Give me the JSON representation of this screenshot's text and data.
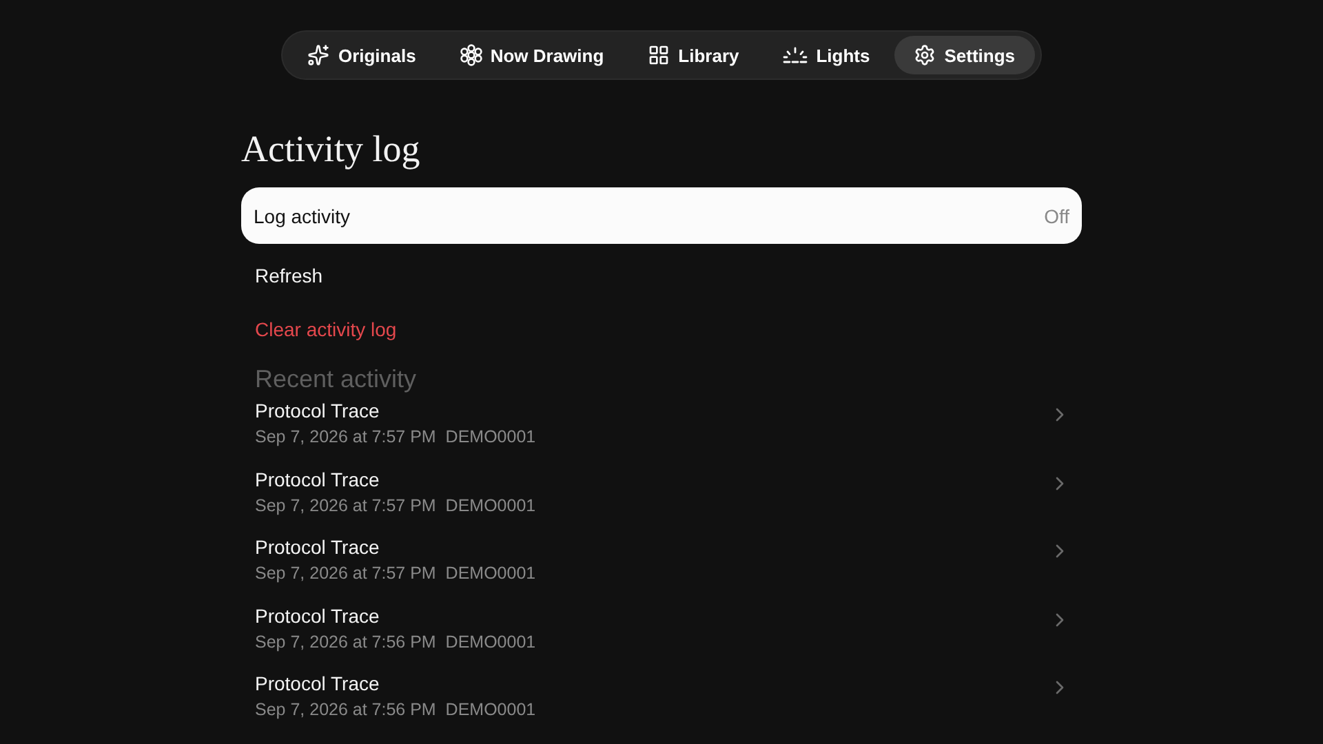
{
  "nav": {
    "tabs": [
      {
        "label": "Originals",
        "kind": "sparkles",
        "selected": false
      },
      {
        "label": "Now Drawing",
        "kind": "cluster",
        "selected": false
      },
      {
        "label": "Library",
        "kind": "grid",
        "selected": false
      },
      {
        "label": "Lights",
        "kind": "lights",
        "selected": false
      },
      {
        "label": "Settings",
        "kind": "gear",
        "selected": true
      }
    ]
  },
  "title": "Activity log",
  "log_toggle": {
    "label": "Log activity",
    "value": "Off"
  },
  "actions": [
    {
      "label": "Refresh",
      "kind": "normal"
    },
    {
      "label": "Clear activity log",
      "kind": "destructive"
    }
  ],
  "recent": {
    "heading": "Recent activity",
    "items": [
      {
        "title": "Protocol Trace",
        "subtitle": "Sep 7, 2026 at 7:57 PM  DEMO0001"
      },
      {
        "title": "Protocol Trace",
        "subtitle": "Sep 7, 2026 at 7:57 PM  DEMO0001"
      },
      {
        "title": "Protocol Trace",
        "subtitle": "Sep 7, 2026 at 7:57 PM  DEMO0001"
      },
      {
        "title": "Protocol Trace",
        "subtitle": "Sep 7, 2026 at 7:56 PM  DEMO0001"
      },
      {
        "title": "Protocol Trace",
        "subtitle": "Sep 7, 2026 at 7:56 PM  DEMO0001"
      }
    ]
  }
}
